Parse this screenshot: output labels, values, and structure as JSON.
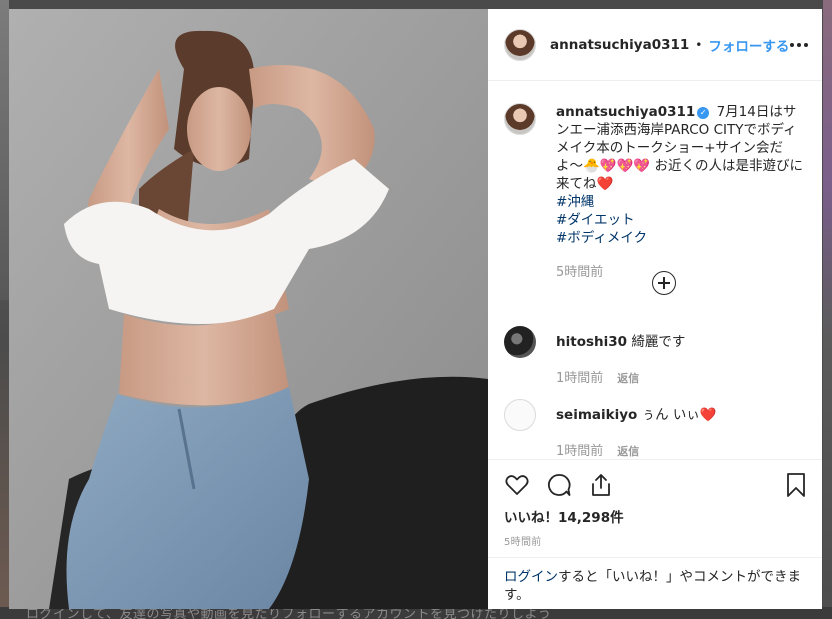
{
  "background": {
    "footer_text": "ログインして、友達の写真や動画を見たりフォローするアカウントを見つけたりしよう"
  },
  "header": {
    "username": "annatsuchiya0311",
    "separator": "•",
    "follow_label": "フォローする"
  },
  "caption": {
    "username": "annatsuchiya0311",
    "text": "7月14日はサンエー浦添西海岸PARCO CITYでボディメイク本のトークショー+サイン会だよ〜🐣💖💖💖 お近くの人は是非遊びに来てね❤️",
    "hashtags": [
      "#沖縄",
      "#ダイエット",
      "#ボディメイク"
    ],
    "time": "5時間前"
  },
  "comments": [
    {
      "username": "hitoshi30",
      "text": "綺麗です",
      "time": "1時間前",
      "reply_label": "返信"
    },
    {
      "username": "seimaikiyo",
      "text": "ぅん いぃ",
      "heart": "❤️",
      "time": "1時間前",
      "reply_label": "返信"
    }
  ],
  "likes": "いいね！14,298件",
  "post_time": "5時間前",
  "login_prompt": {
    "link": "ログイン",
    "text": "すると「いいね！」やコメントができます。"
  },
  "colors": {
    "accent": "#3897f0",
    "link": "#003569",
    "muted": "#999999",
    "heart": "#e0245e"
  }
}
